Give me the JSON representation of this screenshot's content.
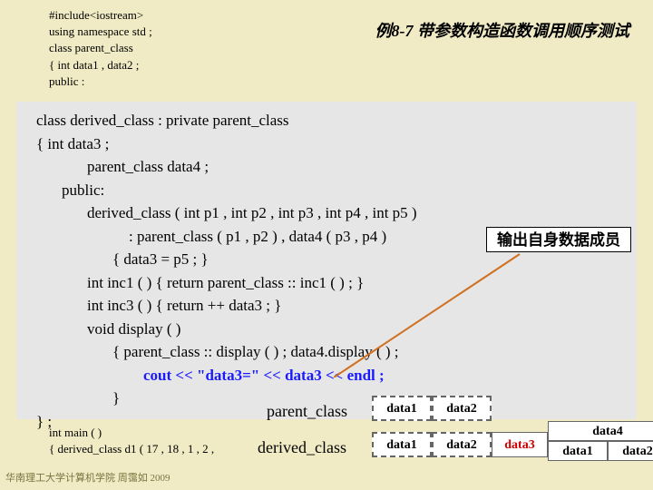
{
  "title": "例8-7  带参数构造函数调用顺序测试",
  "topCode": {
    "l1": "#include<iostream>",
    "l2": "using namespace std ;",
    "l3": "class  parent_class",
    "l4": "{     int  data1 , data2 ;",
    "l5": "   public :"
  },
  "callout": "输出自身数据成员",
  "panel": {
    "l1": "class  derived_class : private  parent_class",
    "l2": "{     int  data3 ;",
    "l3": "parent_class  data4 ;",
    "l4": "public:",
    "l5": "derived_class ( int  p1 , int  p2 , int  p3 , int  p4 , int  p5 )",
    "l6": ": parent_class ( p1 , p2 ) , data4 ( p3 , p4 )",
    "l7": "{ data3 = p5 ;  }",
    "l8": "int  inc1 ( ) { return  parent_class :: inc1 ( ) ; }",
    "l9": "int  inc3 ( ) { return  ++ data3 ; }",
    "l10": "void  display ( )",
    "l11": "{ parent_class :: display ( ) ;   data4.display ( ) ;",
    "l12a": "cout << \"data3=\" << data3 << endl ;",
    "l13": "}",
    "l14": "} ;"
  },
  "labels": {
    "parent": "parent_class",
    "derived": "derived_class",
    "data1": "data1",
    "data2": "data2",
    "data3": "data3",
    "data4": "data4"
  },
  "footer": {
    "l1": "int main ( )",
    "l2": "{ derived_class  d1 ( 17 , 18 , 1 , 2 ,"
  },
  "copyright": "华南理工大学计算机学院 周霭如 2009"
}
